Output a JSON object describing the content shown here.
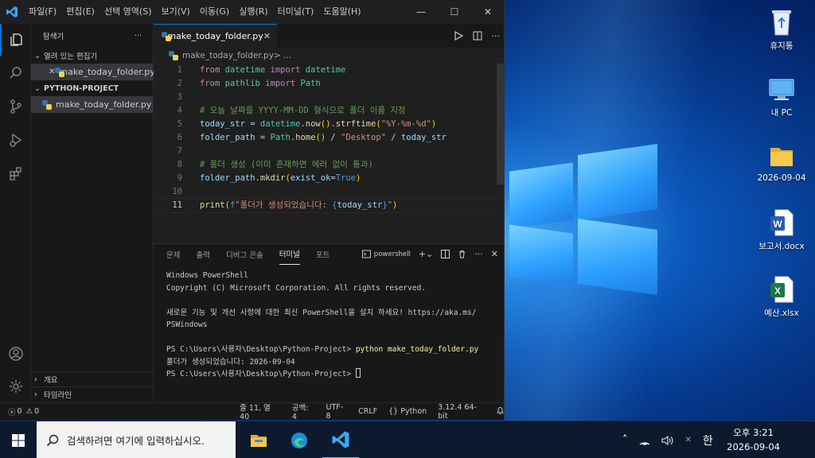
{
  "window": {
    "menu": [
      "파일(F)",
      "편집(E)",
      "선택 영역(S)",
      "보기(V)",
      "이동(G)",
      "실행(R)",
      "터미널(T)",
      "도움말(H)"
    ],
    "controls": {
      "minimize": "—",
      "maximize": "☐",
      "close": "✕"
    }
  },
  "sidebar": {
    "title": "탐색기",
    "more": "···",
    "open_editors": {
      "header": "열려 있는 편집기",
      "close": "✕",
      "file": "make_today_folder.py"
    },
    "project": {
      "header": "PYTHON-PROJECT",
      "file": "make_today_folder.py"
    },
    "outline": "개요",
    "timeline": "타임라인"
  },
  "editor": {
    "tab_label": "make_today_folder.py",
    "tab_close": "✕",
    "breadcrumb": "make_today_folder.py",
    "breadcrumb_sep": " > ...",
    "line_numbers": [
      "1",
      "2",
      "3",
      "4",
      "5",
      "6",
      "7",
      "8",
      "9",
      "10",
      "11"
    ],
    "current_line": 11
  },
  "panel": {
    "tabs": [
      "문제",
      "출력",
      "디버그 콘솔",
      "터미널",
      "포트"
    ],
    "active_tab": "터미널",
    "shell": "powershell",
    "terminal": {
      "l1": "Windows PowerShell",
      "l2": "Copyright (C) Microsoft Corporation. All rights reserved.",
      "l3": "새로운 기능 및 개선 사항에 대한 최신 PowerShell을 설치 하세요! https://aka.ms/",
      "l4": "PSWindows",
      "prompt1": "PS C:\\Users\\사용자\\Desktop\\Python-Project> ",
      "cmd": "python make_today_folder.py",
      "output": "폴더가 생성되었습니다: 2026-09-04",
      "prompt2": "PS C:\\Users\\사용자\\Desktop\\Python-Project> "
    }
  },
  "status": {
    "errors": "0",
    "warnings": "0",
    "position": "줄 11, 열 40",
    "spaces": "공백: 4",
    "encoding": "UTF-8",
    "eol": "CRLF",
    "language": "Python",
    "interpreter": "3.12.4 64-bit"
  },
  "desktop": {
    "icons": [
      {
        "label": "휴지통",
        "icon": "recycle-bin-icon"
      },
      {
        "label": "내 PC",
        "icon": "this-pc-icon"
      },
      {
        "label": "2026-09-04",
        "icon": "folder-icon"
      },
      {
        "label": "보고서.docx",
        "icon": "word-document-icon"
      },
      {
        "label": "예산.xlsx",
        "icon": "excel-document-icon"
      }
    ]
  },
  "taskbar": {
    "search_placeholder": "검색하려면 여기에 입력하십시오.",
    "ime": "한",
    "time": "오후 3:21",
    "date": "2026-09-04"
  },
  "colors": {
    "accent": "#0078d4",
    "taskbar": "#0d1a2d",
    "editor_bg": "#1f1f1f"
  }
}
